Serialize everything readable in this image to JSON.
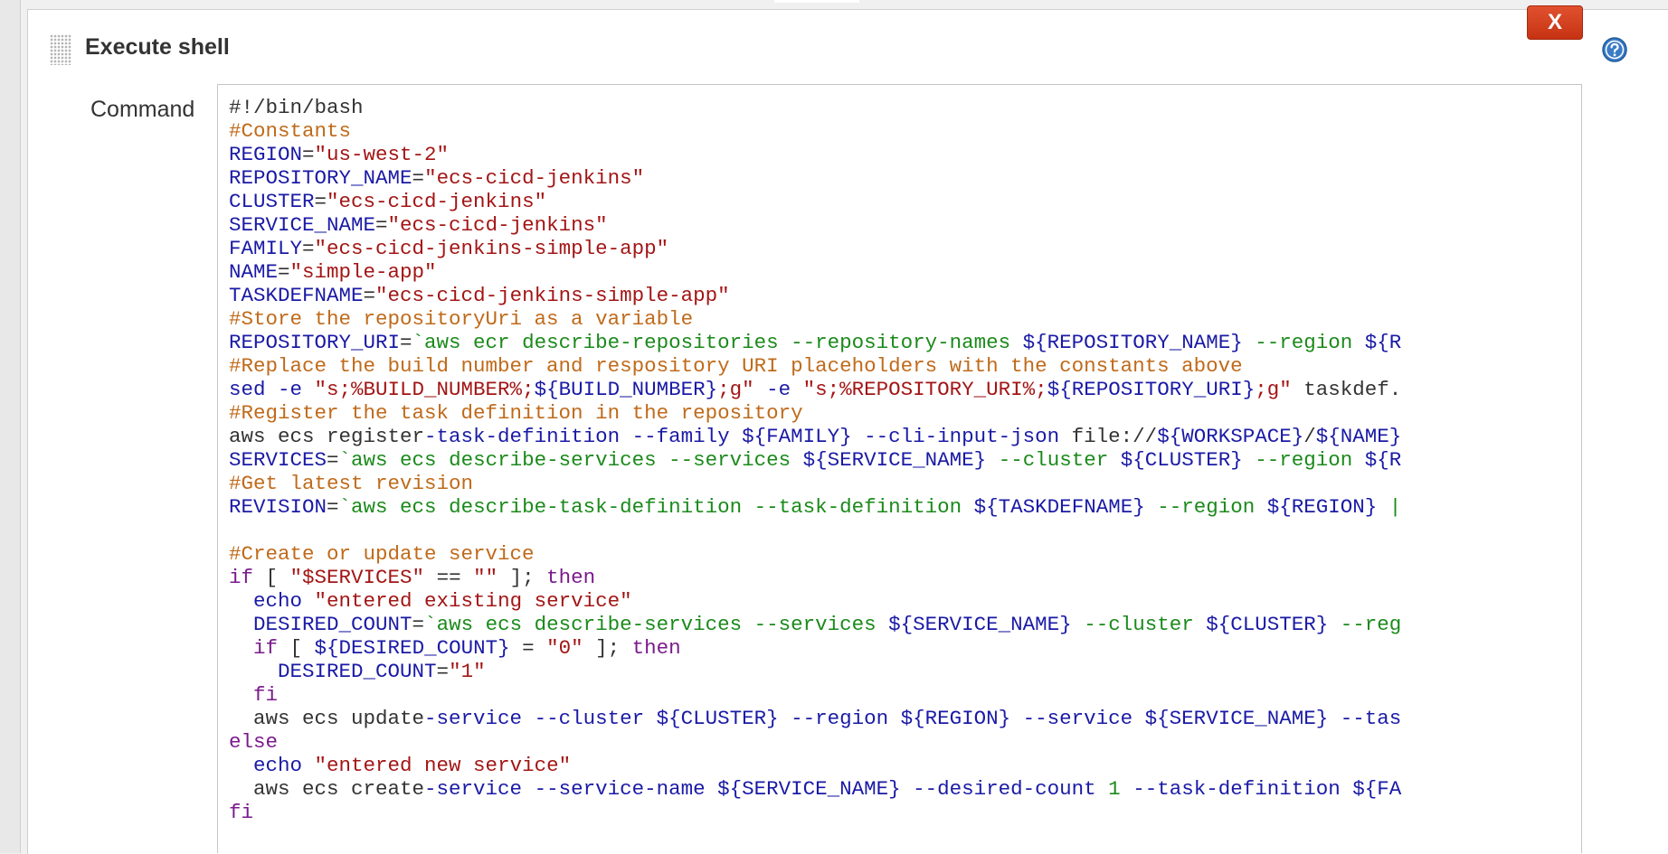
{
  "section": {
    "title": "Execute shell",
    "close_label": "X",
    "field_label": "Command"
  },
  "icons": {
    "drag": "drag-handle-icon",
    "help": "help-icon",
    "help_color": "#2e6fb7",
    "close_color": "#d2401e"
  },
  "code": {
    "lines": [
      [
        [
          "plain",
          "#!/bin/bash"
        ]
      ],
      [
        [
          "comment",
          "#Constants"
        ]
      ],
      [
        [
          "var",
          "REGION"
        ],
        [
          "plain",
          "="
        ],
        [
          "str",
          "\"us-west-2\""
        ]
      ],
      [
        [
          "var",
          "REPOSITORY_NAME"
        ],
        [
          "plain",
          "="
        ],
        [
          "str",
          "\"ecs-cicd-jenkins\""
        ]
      ],
      [
        [
          "var",
          "CLUSTER"
        ],
        [
          "plain",
          "="
        ],
        [
          "str",
          "\"ecs-cicd-jenkins\""
        ]
      ],
      [
        [
          "var",
          "SERVICE_NAME"
        ],
        [
          "plain",
          "="
        ],
        [
          "str",
          "\"ecs-cicd-jenkins\""
        ]
      ],
      [
        [
          "var",
          "FAMILY"
        ],
        [
          "plain",
          "="
        ],
        [
          "str",
          "\"ecs-cicd-jenkins-simple-app\""
        ]
      ],
      [
        [
          "var",
          "NAME"
        ],
        [
          "plain",
          "="
        ],
        [
          "str",
          "\"simple-app\""
        ]
      ],
      [
        [
          "var",
          "TASKDEFNAME"
        ],
        [
          "plain",
          "="
        ],
        [
          "str",
          "\"ecs-cicd-jenkins-simple-app\""
        ]
      ],
      [
        [
          "comment",
          "#Store the repositoryUri as a variable"
        ]
      ],
      [
        [
          "var",
          "REPOSITORY_URI"
        ],
        [
          "plain",
          "="
        ],
        [
          "cmd",
          "`aws ecr describe-repositories --repository-names "
        ],
        [
          "var",
          "${REPOSITORY_NAME}"
        ],
        [
          "cmd",
          " --region "
        ],
        [
          "var",
          "${R"
        ]
      ],
      [
        [
          "comment",
          "#Replace the build number and respository URI placeholders with the constants above"
        ]
      ],
      [
        [
          "var",
          "sed -e "
        ],
        [
          "str",
          "\"s;%BUILD_NUMBER%;"
        ],
        [
          "var",
          "${BUILD_NUMBER}"
        ],
        [
          "str",
          ";g\""
        ],
        [
          "var",
          " -e "
        ],
        [
          "str",
          "\"s;%REPOSITORY_URI%;"
        ],
        [
          "var",
          "${REPOSITORY_URI}"
        ],
        [
          "str",
          ";g\""
        ],
        [
          "plain",
          " taskdef."
        ]
      ],
      [
        [
          "comment",
          "#Register the task definition in the repository"
        ]
      ],
      [
        [
          "plain",
          "aws ecs register"
        ],
        [
          "var",
          "-task-definition --family ${FAMILY} --cli-input-json "
        ],
        [
          "plain",
          "file://"
        ],
        [
          "var",
          "${WORKSPACE}"
        ],
        [
          "plain",
          "/"
        ],
        [
          "var",
          "${NAME}"
        ]
      ],
      [
        [
          "var",
          "SERVICES"
        ],
        [
          "plain",
          "="
        ],
        [
          "cmd",
          "`aws ecs describe-services --services "
        ],
        [
          "var",
          "${SERVICE_NAME}"
        ],
        [
          "cmd",
          " --cluster "
        ],
        [
          "var",
          "${CLUSTER}"
        ],
        [
          "cmd",
          " --region "
        ],
        [
          "var",
          "${R"
        ]
      ],
      [
        [
          "comment",
          "#Get latest revision"
        ]
      ],
      [
        [
          "var",
          "REVISION"
        ],
        [
          "plain",
          "="
        ],
        [
          "cmd",
          "`aws ecs describe-task-definition --task-definition "
        ],
        [
          "var",
          "${TASKDEFNAME}"
        ],
        [
          "cmd",
          " --region "
        ],
        [
          "var",
          "${REGION}"
        ],
        [
          "cmd",
          " |"
        ]
      ],
      [],
      [
        [
          "comment",
          "#Create or update service"
        ]
      ],
      [
        [
          "kw",
          "if"
        ],
        [
          "plain",
          " [ "
        ],
        [
          "str",
          "\"$SERVICES\""
        ],
        [
          "plain",
          " == "
        ],
        [
          "str",
          "\"\""
        ],
        [
          "plain",
          " ]; "
        ],
        [
          "kw",
          "then"
        ]
      ],
      [
        [
          "plain",
          "  "
        ],
        [
          "var",
          "echo "
        ],
        [
          "str",
          "\"entered existing service\""
        ]
      ],
      [
        [
          "plain",
          "  "
        ],
        [
          "var",
          "DESIRED_COUNT"
        ],
        [
          "plain",
          "="
        ],
        [
          "cmd",
          "`aws ecs describe-services --services "
        ],
        [
          "var",
          "${SERVICE_NAME}"
        ],
        [
          "cmd",
          " --cluster "
        ],
        [
          "var",
          "${CLUSTER}"
        ],
        [
          "cmd",
          " --reg"
        ]
      ],
      [
        [
          "plain",
          "  "
        ],
        [
          "kw",
          "if"
        ],
        [
          "plain",
          " [ "
        ],
        [
          "var",
          "${DESIRED_COUNT}"
        ],
        [
          "plain",
          " = "
        ],
        [
          "str",
          "\"0\""
        ],
        [
          "plain",
          " ]; "
        ],
        [
          "kw",
          "then"
        ]
      ],
      [
        [
          "plain",
          "    "
        ],
        [
          "var",
          "DESIRED_COUNT"
        ],
        [
          "plain",
          "="
        ],
        [
          "str",
          "\"1\""
        ]
      ],
      [
        [
          "plain",
          "  "
        ],
        [
          "kw",
          "fi"
        ]
      ],
      [
        [
          "plain",
          "  aws ecs update"
        ],
        [
          "var",
          "-service --cluster ${CLUSTER} --region ${REGION} --service ${SERVICE_NAME} --tas"
        ]
      ],
      [
        [
          "kw",
          "else"
        ]
      ],
      [
        [
          "plain",
          "  "
        ],
        [
          "var",
          "echo "
        ],
        [
          "str",
          "\"entered new service\""
        ]
      ],
      [
        [
          "plain",
          "  aws ecs create"
        ],
        [
          "var",
          "-service --service-name ${SERVICE_NAME} --desired-count "
        ],
        [
          "num",
          "1"
        ],
        [
          "var",
          " --task-definition ${FA"
        ]
      ],
      [
        [
          "kw",
          "fi"
        ]
      ]
    ]
  }
}
